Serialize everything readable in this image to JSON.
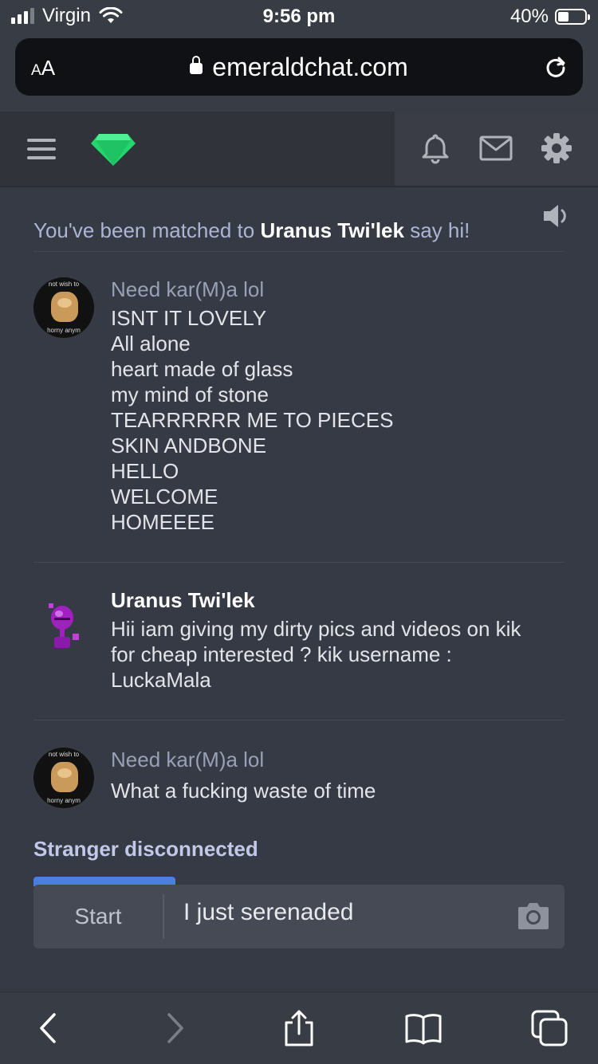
{
  "status_bar": {
    "carrier": "Virgin",
    "time": "9:56 pm",
    "battery_percent": "40%",
    "battery_level": 0.4,
    "signal_bars": 3
  },
  "browser": {
    "text_size_label_small": "A",
    "text_size_label_large": "A",
    "url": "emeraldchat.com"
  },
  "header": {
    "logo_icon": "emerald-gem-icon",
    "icons": [
      "menu-icon",
      "bell-icon",
      "mail-icon",
      "gear-icon"
    ]
  },
  "chat": {
    "match_prefix": "You've been matched to",
    "match_name": "Uranus Twi'lek",
    "match_suffix": "say hi!",
    "messages": [
      {
        "sender": "Need kar(M)a lol",
        "avatar_text_top": "not wish to",
        "avatar_text_bottom": "horny anym",
        "lines": [
          "ISNT IT LOVELY",
          "All alone",
          "heart made of glass",
          "my mind of stone",
          "TEARRRRRR ME TO PIECES",
          "SKIN ANDBONE",
          "HELLO",
          "WELCOME",
          "HOMEEEE"
        ]
      },
      {
        "sender": "Uranus Twi'lek",
        "lines": [
          "Hii iam giving my dirty pics and videos on kik",
          "for cheap interested ? kik username :",
          "LuckaMala"
        ]
      },
      {
        "sender": "Need kar(M)a lol",
        "avatar_text_top": "not wish to",
        "avatar_text_bottom": "horny anym",
        "lines": [
          "What a fucking waste of time"
        ]
      }
    ],
    "status": "Stranger disconnected"
  },
  "composer": {
    "start_label": "Start",
    "input_value": "I just serenaded"
  },
  "colors": {
    "accent_green": "#2ee07a",
    "accent_blue": "#4a7ee0",
    "page_bg": "#363a44"
  }
}
